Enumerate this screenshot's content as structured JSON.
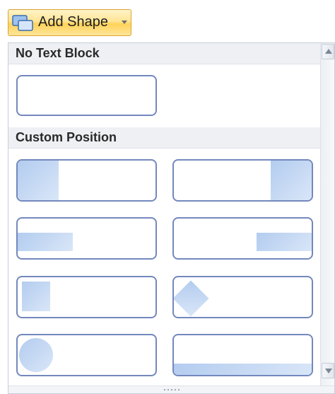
{
  "add_shape_button": {
    "label": "Add Shape",
    "icon": "shape-icon",
    "dropdown_icon": "chevron-down-icon"
  },
  "gallery": {
    "sections": [
      {
        "title": "No Text Block"
      },
      {
        "title": "Custom Position"
      }
    ]
  },
  "colors": {
    "tile_border": "#7388bd",
    "shape_fill": "#b3ccef",
    "header_bg": "#eef0f4",
    "button_highlight": "#ffe494"
  }
}
